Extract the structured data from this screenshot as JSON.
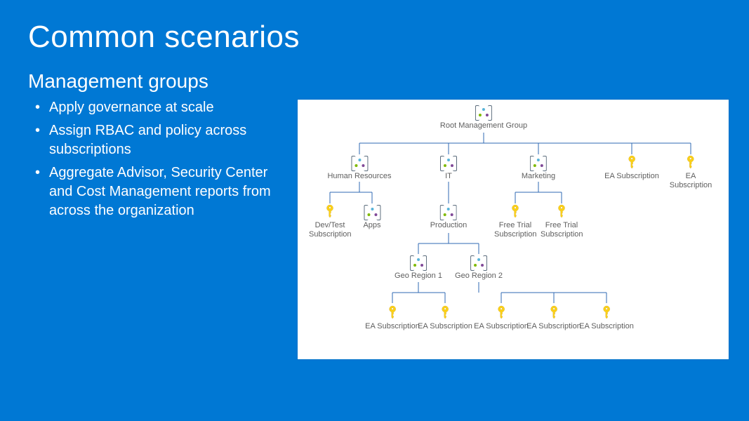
{
  "title": "Common scenarios",
  "section_heading": "Management groups",
  "bullets": [
    "Apply governance at scale",
    "Assign RBAC and policy across subscriptions",
    "Aggregate Advisor, Security Center and Cost Management reports from across the organization"
  ],
  "diagram": {
    "root": "Root Management Group",
    "hr": "Human Resources",
    "it": "IT",
    "marketing": "Marketing",
    "ea_sub_top1": "EA Subscription",
    "ea_sub_top2": "EA Subscription",
    "devtest_sub": "Dev/Test Subscription",
    "apps": "Apps",
    "production": "Production",
    "free_trial1": "Free Trial Subscription",
    "free_trial2": "Free Trial Subscription",
    "geo1": "Geo Region 1",
    "geo2": "Geo Region 2",
    "ea_sub_g1a": "EA Subscription",
    "ea_sub_g1b": "EA Subscription",
    "ea_sub_g2a": "EA Subscription",
    "ea_sub_g2b": "EA Subscription",
    "ea_sub_g2c": "EA Subscription"
  },
  "colors": {
    "slide_bg": "#0078d4",
    "diagram_bg": "#ffffff",
    "key_color": "#fcd116",
    "connector": "#2f69b3"
  }
}
